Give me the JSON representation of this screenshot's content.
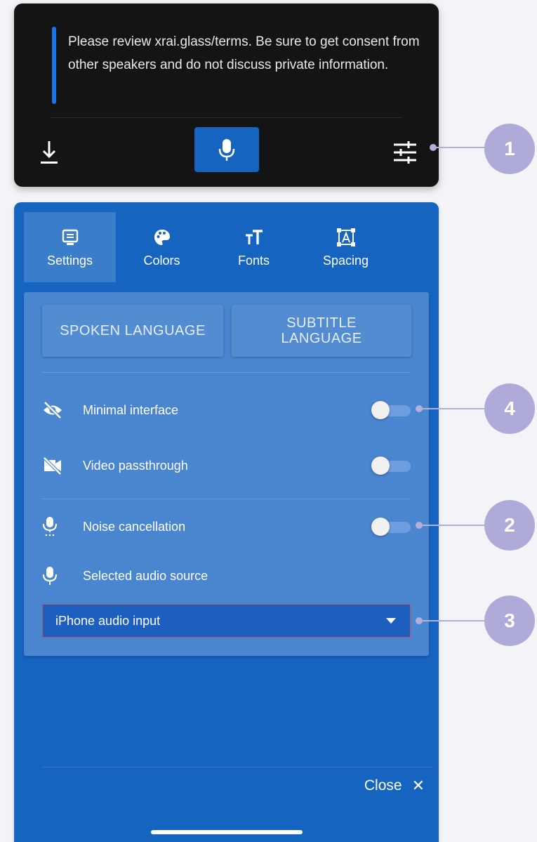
{
  "top_panel": {
    "notice": "Please review xrai.glass/terms. Be sure to get consent from other speakers and do not discuss private information."
  },
  "tabs": [
    {
      "label": "Settings",
      "icon": "settings-screen-icon"
    },
    {
      "label": "Colors",
      "icon": "palette-icon"
    },
    {
      "label": "Fonts",
      "icon": "text-size-icon"
    },
    {
      "label": "Spacing",
      "icon": "spacing-icon"
    }
  ],
  "settings": {
    "spoken_language": "SPOKEN LANGUAGE",
    "subtitle_language": "SUBTITLE LANGUAGE",
    "rows": [
      {
        "label": "Minimal interface",
        "icon": "eye-off-icon",
        "on": false
      },
      {
        "label": "Video passthrough",
        "icon": "video-off-icon",
        "on": false
      },
      {
        "label": "Noise cancellation",
        "icon": "mic-noise-icon",
        "on": false
      },
      {
        "label": "Selected audio source",
        "icon": "mic-icon"
      }
    ],
    "audio_source": "iPhone audio input"
  },
  "footer": {
    "close_label": "Close",
    "close_icon": "✕"
  },
  "callouts": [
    "1",
    "4",
    "2",
    "3"
  ],
  "colors": {
    "panel_blue": "#1565c0",
    "card_blue": "#4a85d0",
    "callout": "#aeabd8",
    "dark": "#141414"
  }
}
